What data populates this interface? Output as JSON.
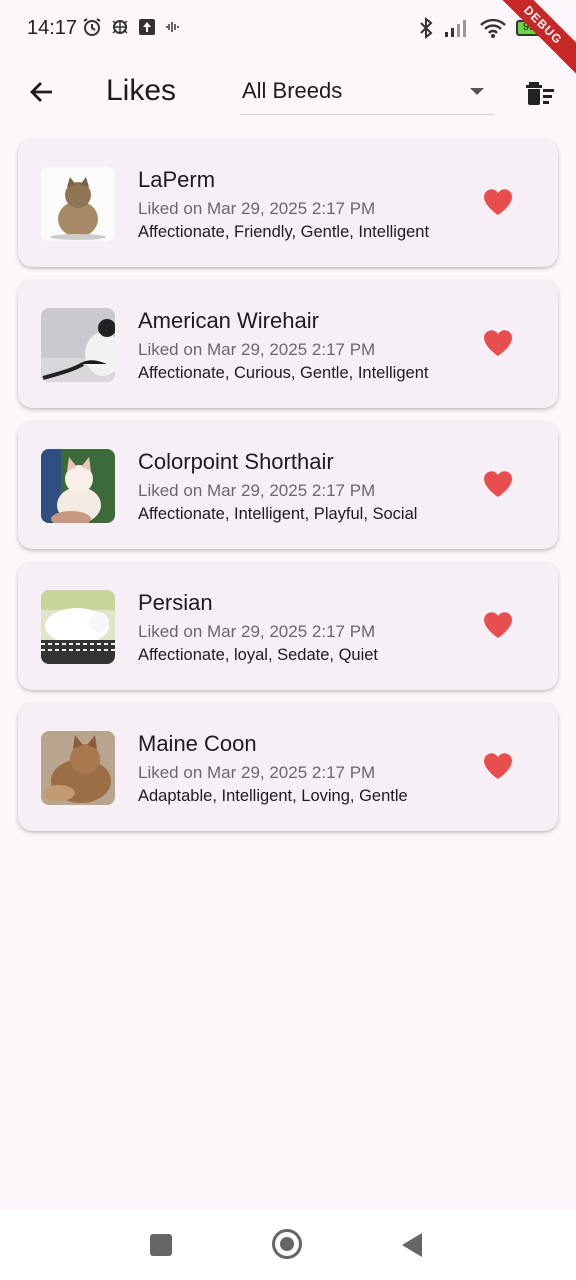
{
  "status_bar": {
    "time": "14:17",
    "battery": "95",
    "debug_label": "DEBUG"
  },
  "app_bar": {
    "title": "Likes",
    "breed_filter": "All Breeds"
  },
  "likes": [
    {
      "name": "LaPerm",
      "liked": "Liked on Mar 29, 2025 2:17 PM",
      "temperament": "Affectionate, Friendly, Gentle, Intelligent"
    },
    {
      "name": "American Wirehair",
      "liked": "Liked on Mar 29, 2025 2:17 PM",
      "temperament": "Affectionate, Curious, Gentle, Intelligent"
    },
    {
      "name": "Colorpoint Shorthair",
      "liked": "Liked on Mar 29, 2025 2:17 PM",
      "temperament": "Affectionate, Intelligent, Playful, Social"
    },
    {
      "name": "Persian",
      "liked": "Liked on Mar 29, 2025 2:17 PM",
      "temperament": "Affectionate, loyal, Sedate, Quiet"
    },
    {
      "name": "Maine Coon",
      "liked": "Liked on Mar 29, 2025 2:17 PM",
      "temperament": "Adaptable, Intelligent, Loving, Gentle"
    }
  ],
  "colors": {
    "heart": "#e84e4e",
    "background": "#fdf7fc",
    "card": "#f6eff6"
  }
}
